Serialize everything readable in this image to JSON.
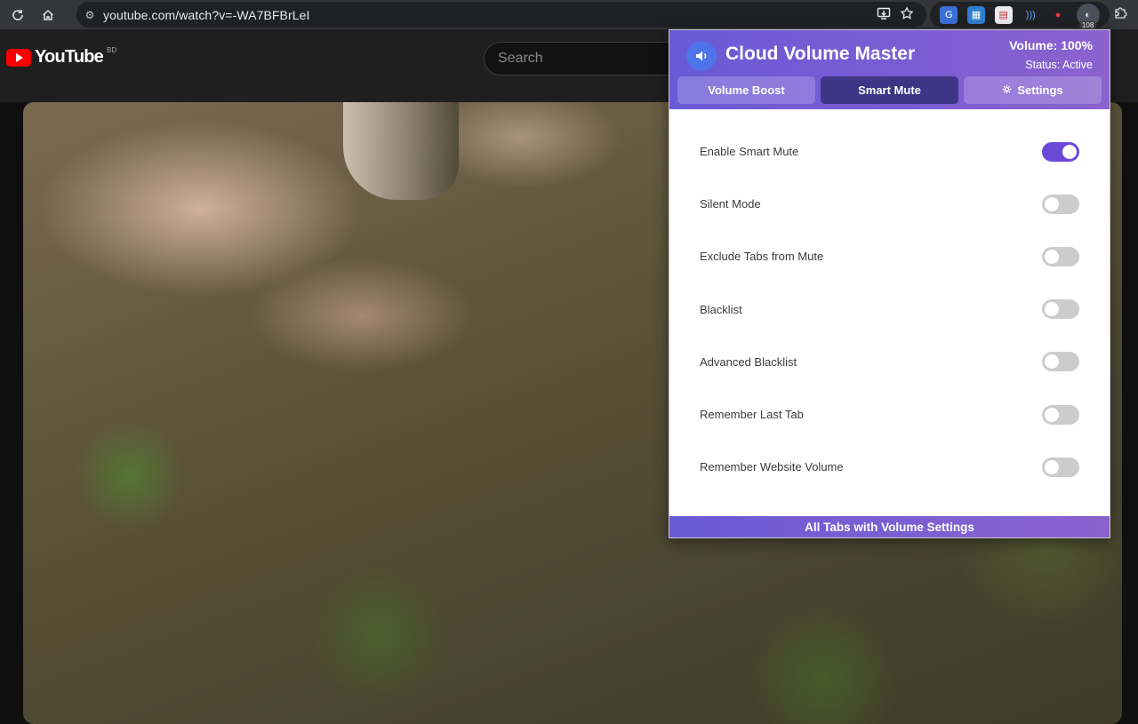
{
  "browser": {
    "url": "youtube.com/watch?v=-WA7BFBrLeI",
    "extension_badge": "108"
  },
  "youtube": {
    "logo_text": "YouTube",
    "region": "BD",
    "search_placeholder": "Search"
  },
  "popup": {
    "title": "Cloud Volume Master",
    "volume": "Volume: 100%",
    "status": "Status: Active",
    "tabs": [
      {
        "label": "Volume Boost",
        "active": false
      },
      {
        "label": "Smart Mute",
        "active": true
      },
      {
        "label": "Settings",
        "active": false
      }
    ],
    "settings": [
      {
        "label": "Enable Smart Mute",
        "on": true
      },
      {
        "label": "Silent Mode",
        "on": false
      },
      {
        "label": "Exclude Tabs from Mute",
        "on": false
      },
      {
        "label": "Blacklist",
        "on": false
      },
      {
        "label": "Advanced Blacklist",
        "on": false
      },
      {
        "label": "Remember Last Tab",
        "on": false
      },
      {
        "label": "Remember Website Volume",
        "on": false
      }
    ],
    "footer": "All Tabs with Volume Settings"
  },
  "colors": {
    "accent": "#6c48d8",
    "header": "#7c5dd2",
    "active_tab": "#3d3585"
  }
}
